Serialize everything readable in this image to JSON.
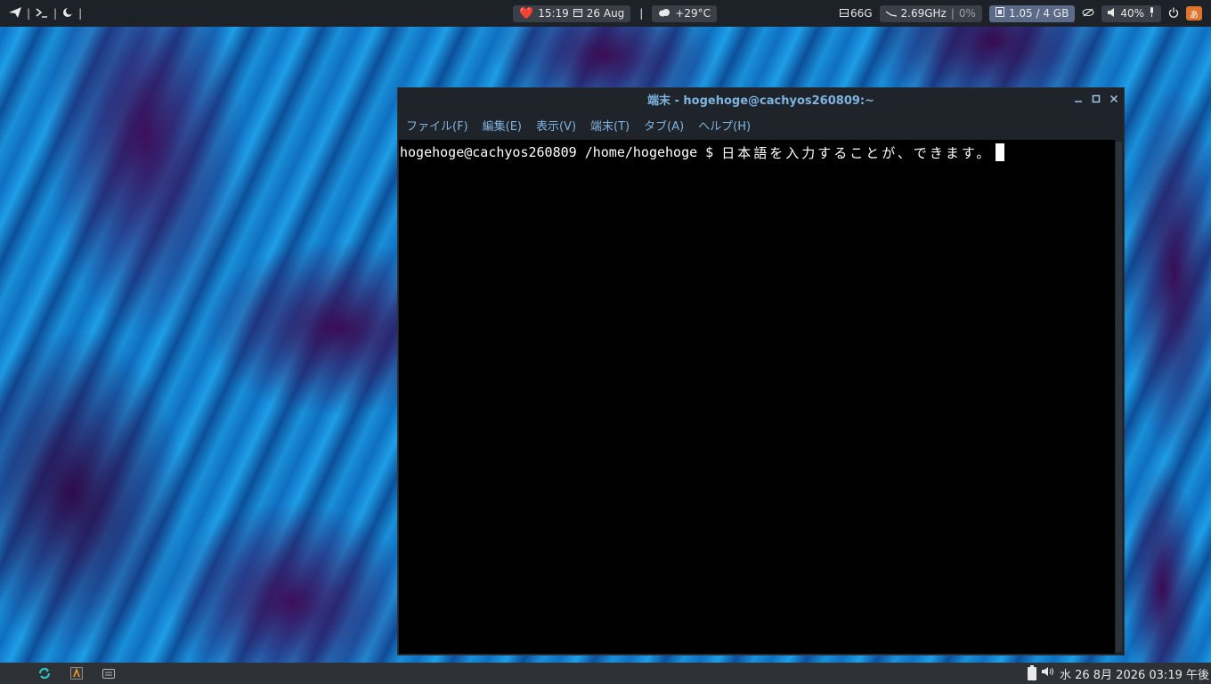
{
  "topbar": {
    "left_icons": [
      "send-icon",
      "terminal-icon",
      "moon-icon"
    ],
    "left_sep": "|",
    "heart_glyph": "❤️",
    "time": "15:19",
    "date": "26 Aug",
    "center_sep": "|",
    "weather": "+29°C",
    "disk": "66G",
    "cpu_freq": "2.69GHz",
    "cpu_sep": "|",
    "cpu_load": "0%",
    "memory": "1.05 / 4 GB",
    "volume": "40%",
    "ime": "あ"
  },
  "window": {
    "title": "端末 - hogehoge@cachyos260809:~",
    "menu": [
      "ファイル(F)",
      "編集(E)",
      "表示(V)",
      "端末(T)",
      "タブ(A)",
      "ヘルプ(H)"
    ],
    "prompt": "hogehoge@cachyos260809 /home/hogehoge $ ",
    "input_text": "日本語を入力することが、できます。"
  },
  "bottombar": {
    "clock": "水 26  8月 2026 03:19 午後"
  },
  "colors": {
    "topbar_bg": "#1d2128",
    "window_accent": "#7fb4e0",
    "terminal_bg": "#000000",
    "heart": "#e0333f",
    "ime_badge": "#e0742a"
  }
}
